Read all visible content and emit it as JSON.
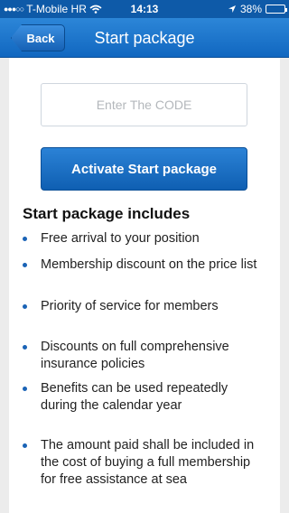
{
  "status_bar": {
    "carrier": "T-Mobile HR",
    "time": "14:13",
    "battery": "38%",
    "battery_level": 0.38
  },
  "nav": {
    "back_label": "Back",
    "title": "Start package"
  },
  "code_input": {
    "placeholder": "Enter The CODE",
    "value": ""
  },
  "activate_button_label": "Activate Start package",
  "includes": {
    "heading": "Start package includes",
    "items": [
      "Free arrival to your position",
      "Membership discount on the price list",
      "Priority of service for members",
      "Discounts on full comprehensive insurance policies",
      "Benefits can be used repeatedly during the calendar year",
      "The amount paid shall be included in the cost of buying a full membership for free assistance at sea"
    ]
  },
  "colors": {
    "nav_blue": "#1167c0",
    "bullet_blue": "#1a63b6"
  }
}
